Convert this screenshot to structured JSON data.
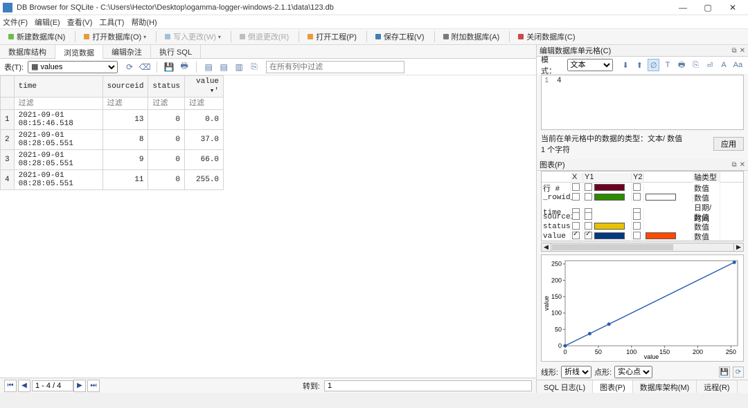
{
  "window": {
    "title": "DB Browser for SQLite - C:\\Users\\Hector\\Desktop\\ogamma-logger-windows-2.1.1\\data\\123.db"
  },
  "menus": {
    "file": "文件(F)",
    "edit": "编辑(E)",
    "view": "查看(V)",
    "tools": "工具(T)",
    "help": "帮助(H)"
  },
  "toolbar": {
    "new_db": "新建数据库(N)",
    "open_db": "打开数据库(O)",
    "write": "写入更改(W)",
    "revert": "倒退更改(R)",
    "open_proj": "打开工程(P)",
    "save_proj": "保存工程(V)",
    "attach": "附加数据库(A)",
    "close_db": "关闭数据库(C)"
  },
  "tabs": {
    "schema": "数据库结构",
    "browse": "浏览数据",
    "edit": "编辑杂注",
    "sql": "执行 SQL"
  },
  "table_pick": {
    "label": "表(T):",
    "selected": "values",
    "filter_all_placeholder": "在所有列中过滤"
  },
  "grid": {
    "columns": {
      "time": "time",
      "sourceid": "sourceid",
      "status": "status",
      "value": "value ▾'"
    },
    "filter_placeholder": "过滤",
    "rows": [
      {
        "n": 1,
        "time": "2021-09-01 08:15:46.518",
        "sourceid": 13,
        "status": 0,
        "value": "0.0"
      },
      {
        "n": 2,
        "time": "2021-09-01 08:28:05.551",
        "sourceid": 8,
        "status": 0,
        "value": "37.0"
      },
      {
        "n": 3,
        "time": "2021-09-01 08:28:05.551",
        "sourceid": 9,
        "status": 0,
        "value": "66.0"
      },
      {
        "n": 4,
        "time": "2021-09-01 08:28:05.551",
        "sourceid": 11,
        "status": 0,
        "value": "255.0"
      }
    ]
  },
  "nav": {
    "range": "1 - 4 / 4",
    "goto_label": "转到:",
    "goto_value": "1"
  },
  "cell_panel": {
    "title": "编辑数据库单元格(C)",
    "mode_label": "模式：",
    "mode_value": "文本",
    "line_no": "1",
    "content": "4",
    "info": "当前在单元格中的数据的类型：文本/ 数值",
    "len": "1 个字符",
    "apply": "应用"
  },
  "plot_panel": {
    "title": "图表(P)",
    "headers": {
      "x": "X",
      "y1": "Y1",
      "y2": "Y2",
      "axis": "轴类型"
    },
    "rows": [
      {
        "name": "行 #",
        "x": false,
        "y1": false,
        "y1c": "#700020",
        "y2": false,
        "y2c": "",
        "axis": "数值"
      },
      {
        "name": "_rowid_",
        "x": false,
        "y1": false,
        "y1c": "#2e8b00",
        "y2": false,
        "y2c": "#ffffff",
        "axis": "数值"
      },
      {
        "name": "time",
        "x": false,
        "y1": false,
        "y1c": "",
        "y2": false,
        "y2c": "",
        "axis": "日期/时间"
      },
      {
        "name": "sourceid",
        "x": false,
        "y1": false,
        "y1c": "",
        "y2": false,
        "y2c": "",
        "axis": "数值"
      },
      {
        "name": "status",
        "x": false,
        "y1": false,
        "y1c": "#e8c200",
        "y2": false,
        "y2c": "",
        "axis": "数值"
      },
      {
        "name": "value",
        "x": true,
        "y1": true,
        "y1c": "#003a80",
        "y2": false,
        "y2c": "#ff4a00",
        "axis": "数值"
      }
    ],
    "line_label": "线形:",
    "line_value": "折线",
    "point_label": "点形:",
    "point_value": "实心点"
  },
  "bottom_tabs": {
    "sql_log": "SQL 日志(L)",
    "plot": "图表(P)",
    "schema": "数据库架构(M)",
    "remote": "远程(R)"
  },
  "chart_data": {
    "type": "line",
    "x": [
      0,
      37,
      66,
      255
    ],
    "y": [
      0,
      37,
      66,
      255
    ],
    "xlabel": "value",
    "ylabel": "value",
    "xlim": [
      0,
      260
    ],
    "ylim": [
      0,
      260
    ],
    "xticks": [
      0,
      50,
      100,
      150,
      200,
      250
    ],
    "yticks": [
      0,
      50,
      100,
      150,
      200,
      250
    ]
  }
}
